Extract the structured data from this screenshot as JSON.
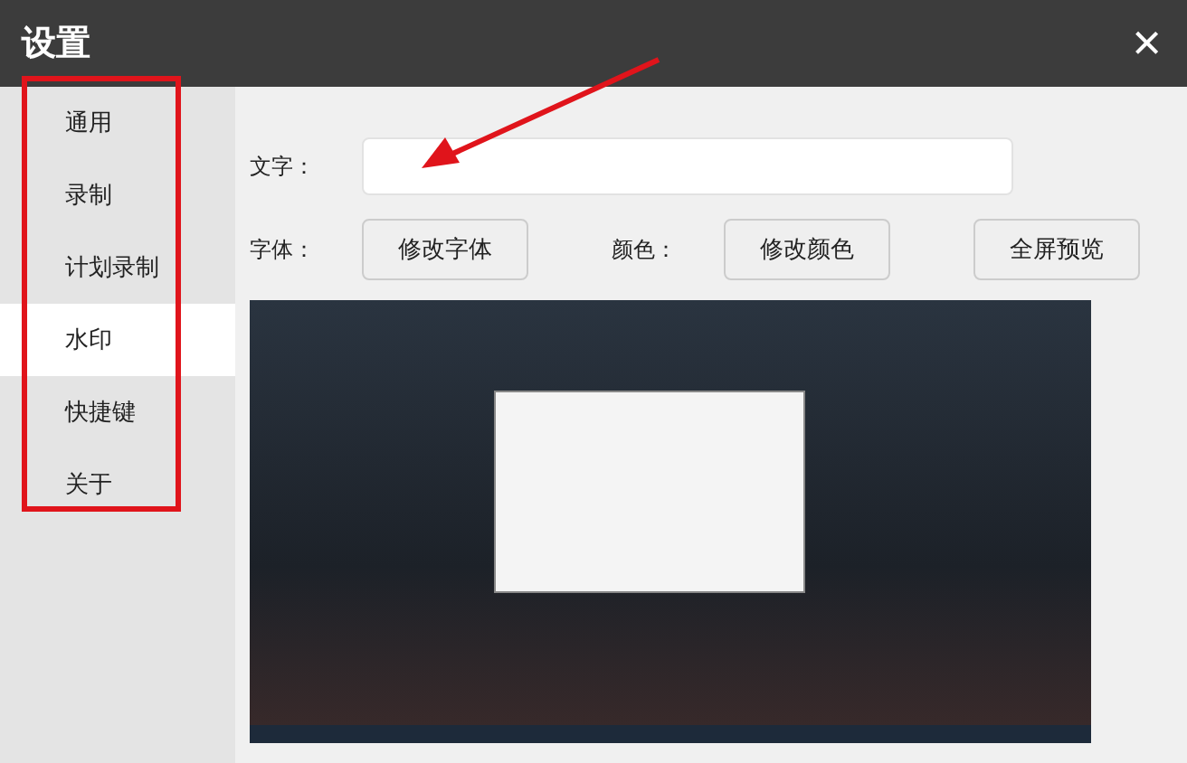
{
  "window": {
    "title": "设置",
    "close": "×"
  },
  "sidebar": {
    "items": [
      {
        "label": "通用",
        "selected": false
      },
      {
        "label": "录制",
        "selected": false
      },
      {
        "label": "计划录制",
        "selected": false
      },
      {
        "label": "水印",
        "selected": true
      },
      {
        "label": "快捷键",
        "selected": false
      },
      {
        "label": "关于",
        "selected": false
      }
    ]
  },
  "watermark": {
    "text_label": "文字：",
    "font_label": "字体：",
    "font_button": "修改字体",
    "color_label": "颜色：",
    "color_button": "修改颜色",
    "preview_button": "全屏预览"
  }
}
